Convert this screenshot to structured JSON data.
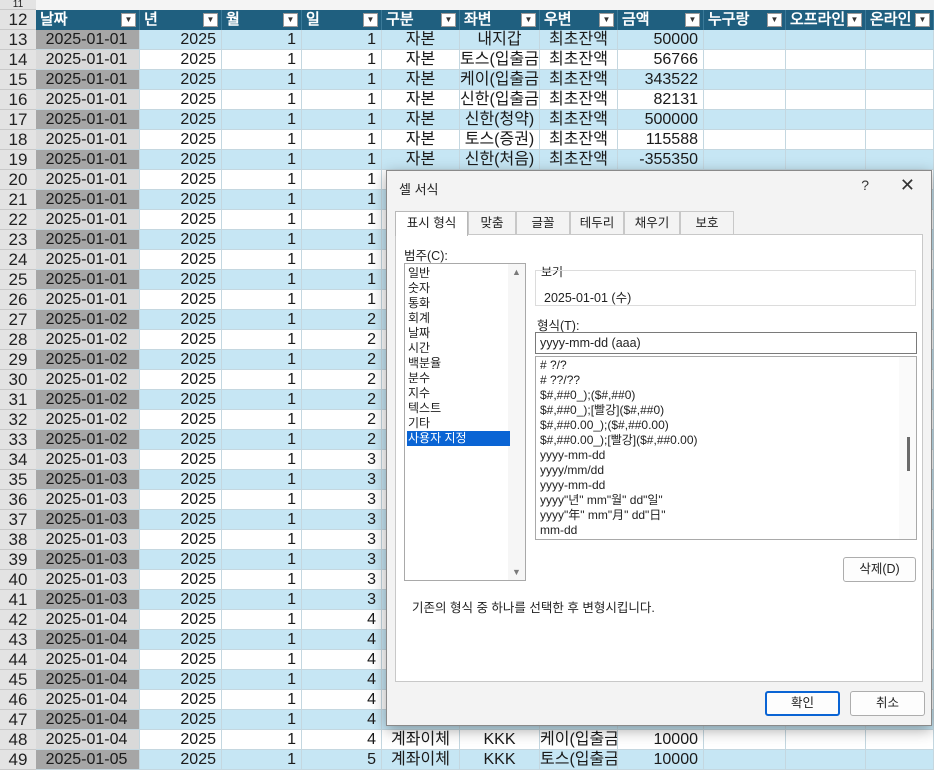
{
  "sheet": {
    "row11_number": "11",
    "header_row_number": "12",
    "columns": [
      "날짜",
      "년",
      "월",
      "일",
      "구분",
      "좌변",
      "우변",
      "금액",
      "누구랑",
      "오프라인",
      "온라인"
    ],
    "rows": [
      {
        "n": "13",
        "date": "2025-01-01",
        "year": "2025",
        "month": "1",
        "day": "1",
        "type": "자본",
        "left": "내지갑",
        "right": "최초잔액",
        "amount": "50000"
      },
      {
        "n": "14",
        "date": "2025-01-01",
        "year": "2025",
        "month": "1",
        "day": "1",
        "type": "자본",
        "left": "토스(입출금)",
        "right": "최초잔액",
        "amount": "56766"
      },
      {
        "n": "15",
        "date": "2025-01-01",
        "year": "2025",
        "month": "1",
        "day": "1",
        "type": "자본",
        "left": "케이(입출금)",
        "right": "최초잔액",
        "amount": "343522"
      },
      {
        "n": "16",
        "date": "2025-01-01",
        "year": "2025",
        "month": "1",
        "day": "1",
        "type": "자본",
        "left": "신한(입출금)",
        "right": "최초잔액",
        "amount": "82131"
      },
      {
        "n": "17",
        "date": "2025-01-01",
        "year": "2025",
        "month": "1",
        "day": "1",
        "type": "자본",
        "left": "신한(청약)",
        "right": "최초잔액",
        "amount": "500000"
      },
      {
        "n": "18",
        "date": "2025-01-01",
        "year": "2025",
        "month": "1",
        "day": "1",
        "type": "자본",
        "left": "토스(증권)",
        "right": "최초잔액",
        "amount": "115588"
      },
      {
        "n": "19",
        "date": "2025-01-01",
        "year": "2025",
        "month": "1",
        "day": "1",
        "type": "자본",
        "left": "신한(처음)",
        "right": "최초잔액",
        "amount": "-355350"
      },
      {
        "n": "20",
        "date": "2025-01-01",
        "year": "2025",
        "month": "1",
        "day": "1",
        "type": "",
        "left": "",
        "right": "",
        "amount": ""
      },
      {
        "n": "21",
        "date": "2025-01-01",
        "year": "2025",
        "month": "1",
        "day": "1",
        "type": "",
        "left": "",
        "right": "",
        "amount": ""
      },
      {
        "n": "22",
        "date": "2025-01-01",
        "year": "2025",
        "month": "1",
        "day": "1",
        "type": "",
        "left": "",
        "right": "",
        "amount": ""
      },
      {
        "n": "23",
        "date": "2025-01-01",
        "year": "2025",
        "month": "1",
        "day": "1",
        "type": "",
        "left": "",
        "right": "",
        "amount": ""
      },
      {
        "n": "24",
        "date": "2025-01-01",
        "year": "2025",
        "month": "1",
        "day": "1",
        "type": "",
        "left": "",
        "right": "",
        "amount": ""
      },
      {
        "n": "25",
        "date": "2025-01-01",
        "year": "2025",
        "month": "1",
        "day": "1",
        "type": "",
        "left": "",
        "right": "",
        "amount": ""
      },
      {
        "n": "26",
        "date": "2025-01-01",
        "year": "2025",
        "month": "1",
        "day": "1",
        "type": "",
        "left": "",
        "right": "",
        "amount": ""
      },
      {
        "n": "27",
        "date": "2025-01-02",
        "year": "2025",
        "month": "1",
        "day": "2",
        "type": "",
        "left": "",
        "right": "",
        "amount": ""
      },
      {
        "n": "28",
        "date": "2025-01-02",
        "year": "2025",
        "month": "1",
        "day": "2",
        "type": "",
        "left": "",
        "right": "",
        "amount": ""
      },
      {
        "n": "29",
        "date": "2025-01-02",
        "year": "2025",
        "month": "1",
        "day": "2",
        "type": "",
        "left": "",
        "right": "",
        "amount": ""
      },
      {
        "n": "30",
        "date": "2025-01-02",
        "year": "2025",
        "month": "1",
        "day": "2",
        "type": "",
        "left": "",
        "right": "",
        "amount": ""
      },
      {
        "n": "31",
        "date": "2025-01-02",
        "year": "2025",
        "month": "1",
        "day": "2",
        "type": "",
        "left": "",
        "right": "",
        "amount": ""
      },
      {
        "n": "32",
        "date": "2025-01-02",
        "year": "2025",
        "month": "1",
        "day": "2",
        "type": "",
        "left": "",
        "right": "",
        "amount": ""
      },
      {
        "n": "33",
        "date": "2025-01-02",
        "year": "2025",
        "month": "1",
        "day": "2",
        "type": "",
        "left": "",
        "right": "",
        "amount": ""
      },
      {
        "n": "34",
        "date": "2025-01-03",
        "year": "2025",
        "month": "1",
        "day": "3",
        "type": "",
        "left": "",
        "right": "",
        "amount": ""
      },
      {
        "n": "35",
        "date": "2025-01-03",
        "year": "2025",
        "month": "1",
        "day": "3",
        "type": "",
        "left": "",
        "right": "",
        "amount": ""
      },
      {
        "n": "36",
        "date": "2025-01-03",
        "year": "2025",
        "month": "1",
        "day": "3",
        "type": "",
        "left": "",
        "right": "",
        "amount": ""
      },
      {
        "n": "37",
        "date": "2025-01-03",
        "year": "2025",
        "month": "1",
        "day": "3",
        "type": "",
        "left": "",
        "right": "",
        "amount": ""
      },
      {
        "n": "38",
        "date": "2025-01-03",
        "year": "2025",
        "month": "1",
        "day": "3",
        "type": "",
        "left": "",
        "right": "",
        "amount": ""
      },
      {
        "n": "39",
        "date": "2025-01-03",
        "year": "2025",
        "month": "1",
        "day": "3",
        "type": "",
        "left": "",
        "right": "",
        "amount": ""
      },
      {
        "n": "40",
        "date": "2025-01-03",
        "year": "2025",
        "month": "1",
        "day": "3",
        "type": "",
        "left": "",
        "right": "",
        "amount": ""
      },
      {
        "n": "41",
        "date": "2025-01-03",
        "year": "2025",
        "month": "1",
        "day": "3",
        "type": "",
        "left": "",
        "right": "",
        "amount": ""
      },
      {
        "n": "42",
        "date": "2025-01-04",
        "year": "2025",
        "month": "1",
        "day": "4",
        "type": "",
        "left": "",
        "right": "",
        "amount": ""
      },
      {
        "n": "43",
        "date": "2025-01-04",
        "year": "2025",
        "month": "1",
        "day": "4",
        "type": "",
        "left": "",
        "right": "",
        "amount": ""
      },
      {
        "n": "44",
        "date": "2025-01-04",
        "year": "2025",
        "month": "1",
        "day": "4",
        "type": "",
        "left": "",
        "right": "",
        "amount": ""
      },
      {
        "n": "45",
        "date": "2025-01-04",
        "year": "2025",
        "month": "1",
        "day": "4",
        "type": "",
        "left": "",
        "right": "",
        "amount": ""
      },
      {
        "n": "46",
        "date": "2025-01-04",
        "year": "2025",
        "month": "1",
        "day": "4",
        "type": "",
        "left": "",
        "right": "",
        "amount": ""
      },
      {
        "n": "47",
        "date": "2025-01-04",
        "year": "2025",
        "month": "1",
        "day": "4",
        "type": "",
        "left": "",
        "right": "",
        "amount": ""
      },
      {
        "n": "48",
        "date": "2025-01-04",
        "year": "2025",
        "month": "1",
        "day": "4",
        "type": "계좌이체",
        "left": "KKK",
        "right": "케이(입출금)",
        "amount": "10000"
      },
      {
        "n": "49",
        "date": "2025-01-05",
        "year": "2025",
        "month": "1",
        "day": "5",
        "type": "계좌이체",
        "left": "KKK",
        "right": "토스(입출금)",
        "amount": "10000"
      }
    ]
  },
  "dialog": {
    "title": "셀 서식",
    "help": "?",
    "close": "✕",
    "tabs": [
      "표시 형식",
      "맞춤",
      "글꼴",
      "테두리",
      "채우기",
      "보호"
    ],
    "category_label": "범주(C):",
    "categories": [
      "일반",
      "숫자",
      "통화",
      "회계",
      "날짜",
      "시간",
      "백분율",
      "분수",
      "지수",
      "텍스트",
      "기타",
      "사용자 지정"
    ],
    "selected_category_index": 11,
    "preview_label": "보기",
    "preview_value": "2025-01-01 (수)",
    "format_label": "형식(T):",
    "format_value": "yyyy-mm-dd (aaa)",
    "format_list": [
      "# ?/?",
      "# ??/??",
      "$#,##0_);($#,##0)",
      "$#,##0_);[빨강]($#,##0)",
      "$#,##0.00_);($#,##0.00)",
      "$#,##0.00_);[빨강]($#,##0.00)",
      "yyyy-mm-dd",
      "yyyy/mm/dd",
      "yyyy-mm-dd",
      "yyyy\"년\" mm\"월\" dd\"일\"",
      "yyyy\"年\" mm\"月\" dd\"日\"",
      "mm-dd"
    ],
    "delete_button": "삭제(D)",
    "description": "기존의 형식 중 하나를 선택한 후 변형시킵니다.",
    "ok_button": "확인",
    "cancel_button": "취소"
  },
  "colors": {
    "header_bg": "#1f5f7f",
    "band_blue": "#c6e6f4",
    "band_white": "#ffffff",
    "date_col_selected": "#a6a6a6",
    "accent": "#0a64d4"
  }
}
